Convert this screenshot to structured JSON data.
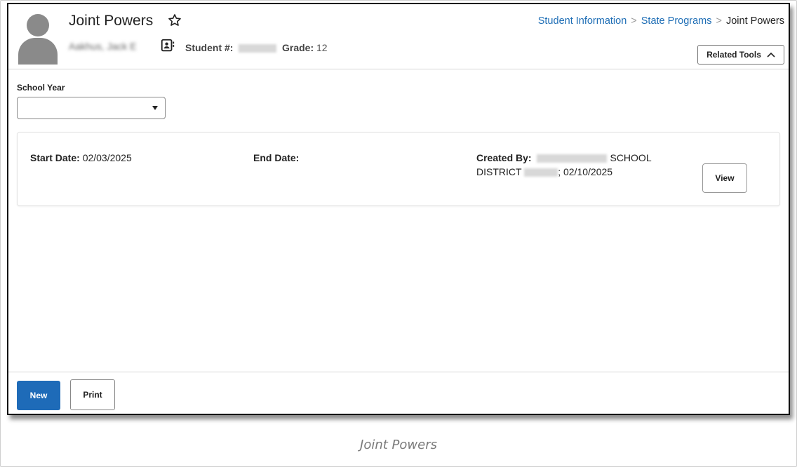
{
  "header": {
    "title": "Joint Powers",
    "student_name": "Aakhus, Jack E",
    "student_number_label": "Student #:",
    "grade_label": "Grade:",
    "grade_value": "12"
  },
  "breadcrumb": {
    "items": [
      "Student Information",
      "State Programs",
      "Joint Powers"
    ]
  },
  "related_tools": {
    "label": "Related Tools"
  },
  "school_year": {
    "label": "School Year",
    "value": ""
  },
  "record": {
    "start_date_label": "Start Date:",
    "start_date_value": "02/03/2025",
    "end_date_label": "End Date:",
    "end_date_value": "",
    "created_by_label": "Created By",
    "created_by_line1_suffix": "SCHOOL",
    "created_by_line2_prefix": "DISTRICT",
    "created_by_line2_suffix": "; 02/10/2025",
    "view_label": "View"
  },
  "footer": {
    "new_label": "New",
    "print_label": "Print"
  },
  "caption": "Joint Powers",
  "colors": {
    "link": "#1d6db5",
    "primary_button": "#1e6bb8"
  },
  "icons": {
    "favorite": "star-outline-icon",
    "contact": "contact-card-icon",
    "chevron": "chevron-up-icon",
    "select_caret": "caret-down-icon"
  }
}
